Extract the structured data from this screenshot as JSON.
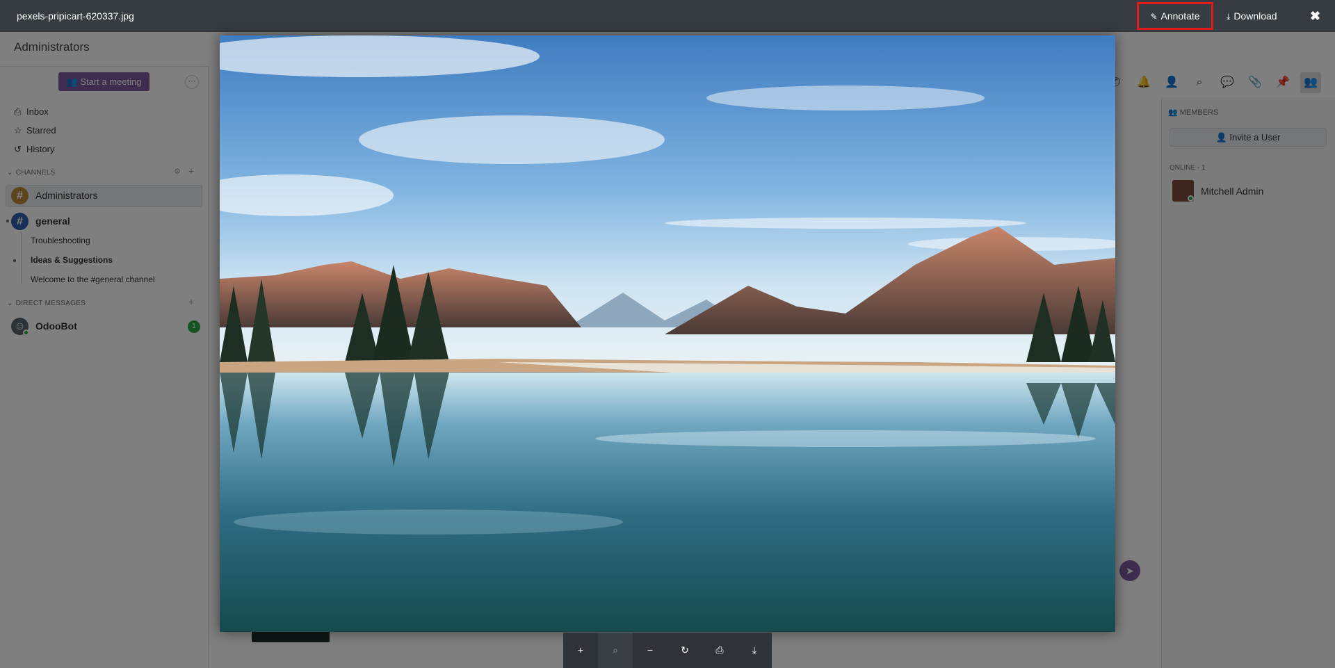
{
  "app": {
    "title": "Administrators",
    "sidebar": {
      "meeting_button": "Start a meeting",
      "links": [
        {
          "label": "Inbox",
          "icon": "inbox-icon",
          "glyph": "⎙"
        },
        {
          "label": "Starred",
          "icon": "star-icon",
          "glyph": "☆"
        },
        {
          "label": "History",
          "icon": "history-icon",
          "glyph": "↺"
        }
      ],
      "channels_header": "CHANNELS",
      "channels": [
        {
          "name": "Administrators",
          "color": "#b98a3a",
          "active": true
        },
        {
          "name": "general",
          "color": "#2e5ea8",
          "active": false
        }
      ],
      "sub_threads": [
        "Troubleshooting",
        "Ideas & Suggestions",
        "Welcome to the #general channel"
      ],
      "dm_header": "DIRECT MESSAGES",
      "dms": [
        {
          "name": "OdooBot",
          "unread": "1"
        }
      ]
    },
    "members": {
      "header": "MEMBERS",
      "invite_button": "Invite a User",
      "online_header": "ONLINE - 1",
      "list": [
        {
          "name": "Mitchell Admin"
        }
      ]
    }
  },
  "viewer": {
    "filename": "pexels-pripicart-620337.jpg",
    "annotate_label": "Annotate",
    "download_label": "Download",
    "close_glyph": "✖",
    "toolbar": [
      {
        "name": "zoom-in-button",
        "glyph": "+",
        "enabled": true
      },
      {
        "name": "zoom-reset-button",
        "glyph": "⌕",
        "enabled": false
      },
      {
        "name": "zoom-out-button",
        "glyph": "−",
        "enabled": true
      },
      {
        "name": "rotate-button",
        "glyph": "↻",
        "enabled": true
      },
      {
        "name": "print-button",
        "glyph": "⎙",
        "enabled": true
      },
      {
        "name": "download-toolbar-button",
        "glyph": "⤓",
        "enabled": true
      }
    ]
  },
  "colors": {
    "header_bg": "#373b42",
    "highlight_border": "#e01b1b",
    "brand": "#7c5a9e",
    "online": "#28a745"
  }
}
